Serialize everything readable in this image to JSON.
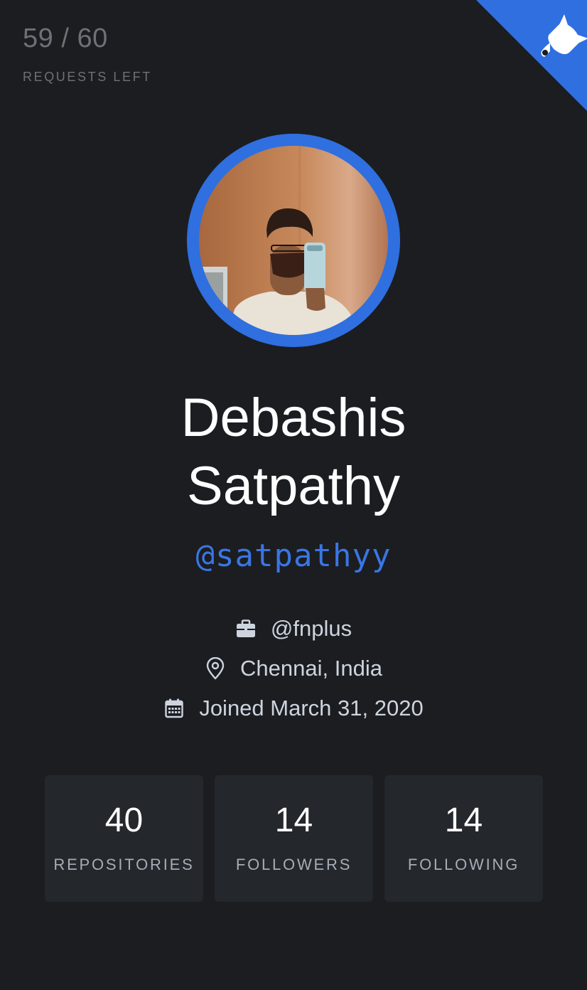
{
  "rate_limit": {
    "count": "59 / 60",
    "label": "REQUESTS LEFT"
  },
  "corner": {
    "icon": "github-octocat-icon",
    "color": "#2f6fe0"
  },
  "profile": {
    "avatar_icon": "user-avatar",
    "name_line1": "Debashis",
    "name_line2": "Satpathy",
    "login": "@satpathyy"
  },
  "info": {
    "company": "@fnplus",
    "location": "Chennai, India",
    "joined": "Joined March 31, 2020"
  },
  "stats": [
    {
      "value": "40",
      "label": "REPOSITORIES"
    },
    {
      "value": "14",
      "label": "FOLLOWERS"
    },
    {
      "value": "14",
      "label": "FOLLOWING"
    }
  ],
  "colors": {
    "background": "#1b1d21",
    "accent": "#2f6fe0",
    "card": "#24272c"
  }
}
